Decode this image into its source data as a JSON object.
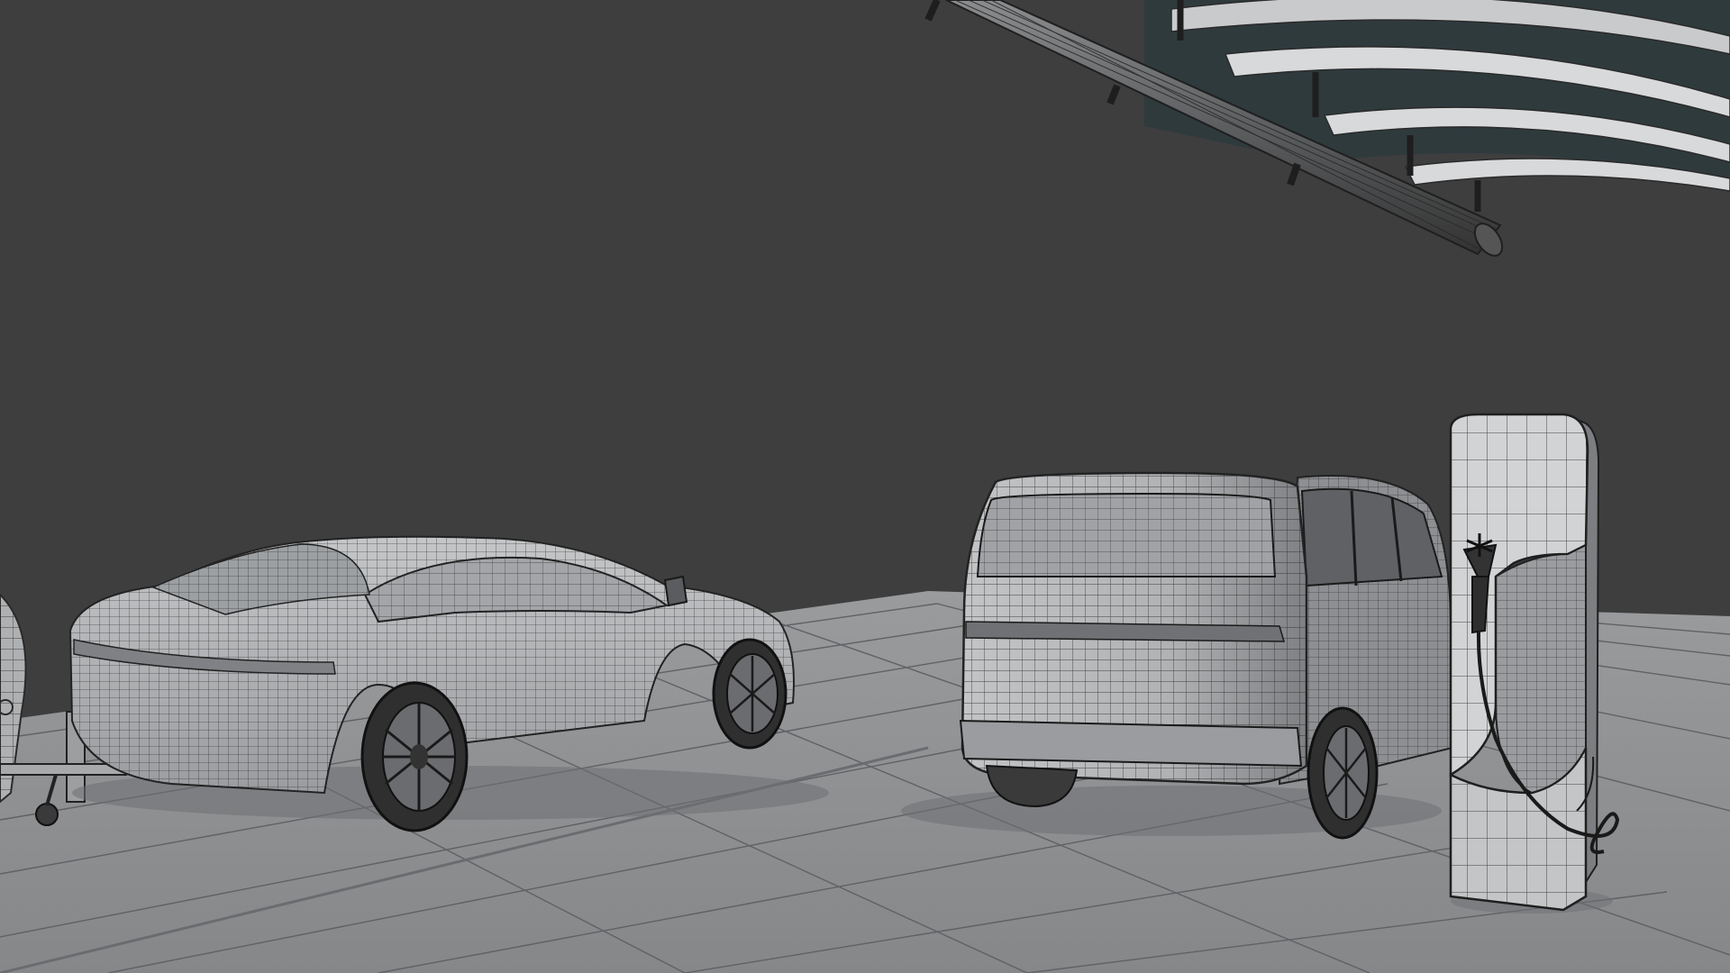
{
  "scene": {
    "background_color": "#3e3e3e",
    "floor_color": "#8e9092",
    "floor_line_color": "#5f6164",
    "model_fill": "#b4b6b8",
    "model_shadow": "#8a8c8f",
    "wire_color": "#2a2a2a",
    "tire_color": "#2f2f2f",
    "ceiling_glass": "#2f3a3d",
    "render_style": "wireframe-on-shaded"
  },
  "objects": [
    {
      "name": "sedan-model"
    },
    {
      "name": "van-model"
    },
    {
      "name": "ev-charger-model"
    },
    {
      "name": "overhead-pipe"
    },
    {
      "name": "curved-canopy"
    },
    {
      "name": "wheel-cover-partial"
    },
    {
      "name": "tow-hitch-stand"
    }
  ]
}
